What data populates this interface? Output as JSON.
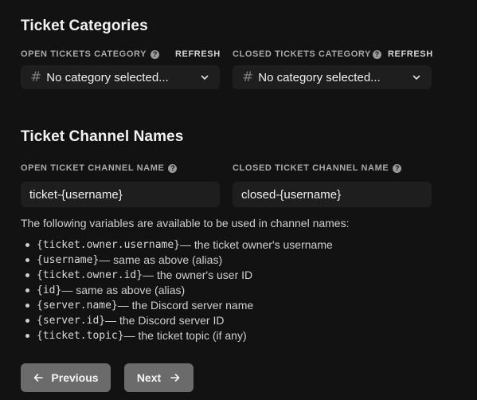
{
  "categories_section": {
    "title": "Ticket Categories",
    "open": {
      "label": "OPEN TICKETS CATEGORY",
      "refresh": "REFRESH",
      "selected": "No category selected..."
    },
    "closed": {
      "label": "CLOSED TICKETS CATEGORY",
      "refresh": "REFRESH",
      "selected": "No category selected..."
    }
  },
  "names_section": {
    "title": "Ticket Channel Names",
    "open": {
      "label": "OPEN TICKET CHANNEL NAME",
      "value": "ticket-{username}"
    },
    "closed": {
      "label": "CLOSED TICKET CHANNEL NAME",
      "value": "closed-{username}"
    },
    "info": "The following variables are available to be used in channel names:",
    "variables": [
      {
        "code": "{ticket.owner.username}",
        "desc": " — the ticket owner's username"
      },
      {
        "code": "{username}",
        "desc": " — same as above (alias)"
      },
      {
        "code": "{ticket.owner.id}",
        "desc": " — the owner's user ID"
      },
      {
        "code": "{id}",
        "desc": " — same as above (alias)"
      },
      {
        "code": "{server.name}",
        "desc": " — the Discord server name"
      },
      {
        "code": "{server.id}",
        "desc": " — the Discord server ID"
      },
      {
        "code": "{ticket.topic}",
        "desc": " — the ticket topic (if any)"
      }
    ]
  },
  "nav": {
    "previous": "Previous",
    "next": "Next"
  },
  "icons": {
    "help": "help-icon",
    "hash": "hash-icon",
    "chevron": "chevron-down-icon",
    "arrow_left": "arrow-left-icon",
    "arrow_right": "arrow-right-icon"
  },
  "colors": {
    "background": "#121212",
    "input_bg": "#1e1e1e",
    "button_bg": "#6b6b6b"
  }
}
